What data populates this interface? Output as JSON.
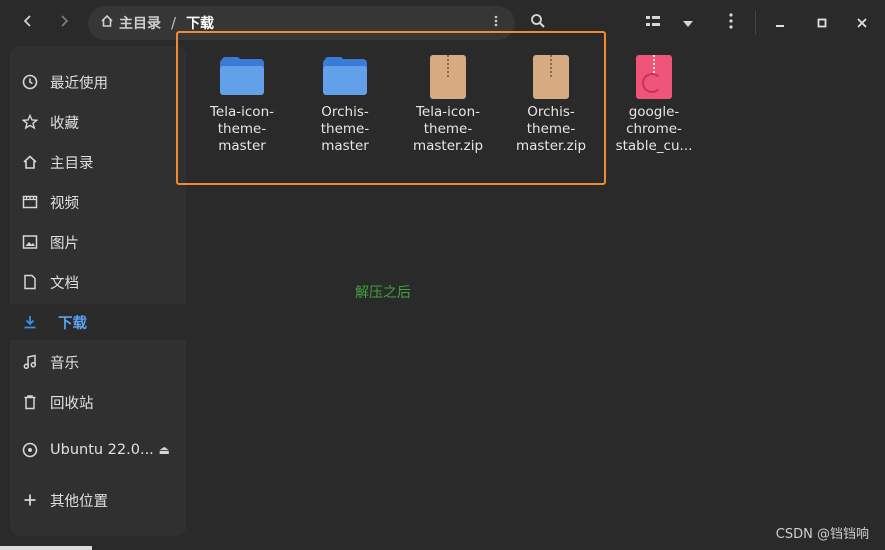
{
  "header": {
    "back_icon": "chevron-left-icon",
    "forward_icon": "chevron-right-icon",
    "path": {
      "home_label": "主目录",
      "separator": "/",
      "current": "下载"
    },
    "menu_icon": "vertical-dots-icon",
    "search_icon": "search-icon",
    "view_icon": "list-view-icon",
    "view_dropdown_icon": "chevron-down-icon",
    "window_controls": {
      "minimize": "–",
      "maximize": "▫",
      "close": "✕"
    }
  },
  "sidebar": {
    "items": [
      {
        "label": "最近使用",
        "icon": "clock-icon"
      },
      {
        "label": "收藏",
        "icon": "star-icon"
      },
      {
        "label": "主目录",
        "icon": "home-icon"
      },
      {
        "label": "视频",
        "icon": "video-icon"
      },
      {
        "label": "图片",
        "icon": "image-icon"
      },
      {
        "label": "文档",
        "icon": "document-icon"
      },
      {
        "label": "下载",
        "icon": "download-icon",
        "active": true
      },
      {
        "label": "音乐",
        "icon": "music-icon"
      },
      {
        "label": "回收站",
        "icon": "trash-icon"
      },
      {
        "label": "Ubuntu 22.0...",
        "icon": "disc-icon",
        "eject": "⏏"
      },
      {
        "label": "其他位置",
        "icon": "plus-icon"
      }
    ]
  },
  "files": [
    {
      "name": "Tela-icon-theme-master",
      "lines": [
        "Tela-icon-",
        "theme-",
        "master"
      ],
      "type": "folder"
    },
    {
      "name": "Orchis-theme-master",
      "lines": [
        "Orchis-",
        "theme-",
        "master"
      ],
      "type": "folder"
    },
    {
      "name": "Tela-icon-theme-master.zip",
      "lines": [
        "Tela-icon-",
        "theme-",
        "master.zip"
      ],
      "type": "zip"
    },
    {
      "name": "Orchis-theme-master.zip",
      "lines": [
        "Orchis-",
        "theme-",
        "master.zip"
      ],
      "type": "zip"
    },
    {
      "name": "google-chrome-stable_cu...",
      "lines": [
        "google-",
        "chrome-",
        "stable_cu..."
      ],
      "type": "deb"
    }
  ],
  "annotation": "解压之后",
  "watermark": "CSDN @铛铛响",
  "colors": {
    "accent": "#3d8ee6",
    "highlight_border": "#f28a30",
    "annotation": "#3fa23f",
    "folder": "#62a0ea",
    "zip": "#d6ab82",
    "deb": "#ee5578"
  }
}
